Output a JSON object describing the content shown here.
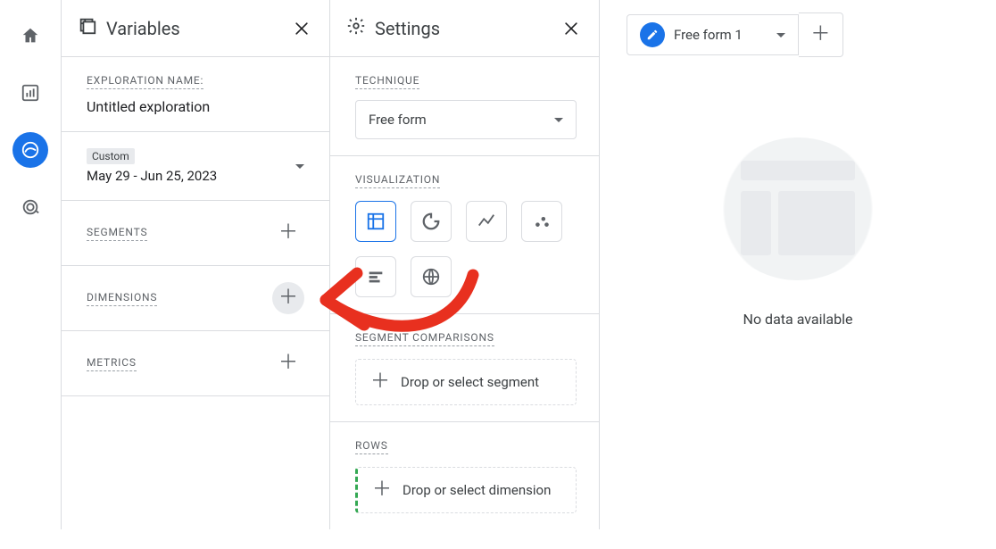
{
  "variables_panel": {
    "title": "Variables",
    "exploration_name_label": "EXPLORATION NAME:",
    "exploration_name_value": "Untitled exploration",
    "date_chip": "Custom",
    "date_range_text": "May 29 - Jun 25, 2023",
    "segments_label": "SEGMENTS",
    "dimensions_label": "DIMENSIONS",
    "metrics_label": "METRICS"
  },
  "settings_panel": {
    "title": "Settings",
    "technique_label": "TECHNIQUE",
    "technique_value": "Free form",
    "visualization_label": "VISUALIZATION",
    "segment_comparisons_label": "SEGMENT COMPARISONS",
    "drop_segment_text": "Drop or select segment",
    "rows_label": "ROWS",
    "drop_dimension_text": "Drop or select dimension"
  },
  "canvas": {
    "tab_label": "Free form 1",
    "no_data_text": "No data available"
  }
}
